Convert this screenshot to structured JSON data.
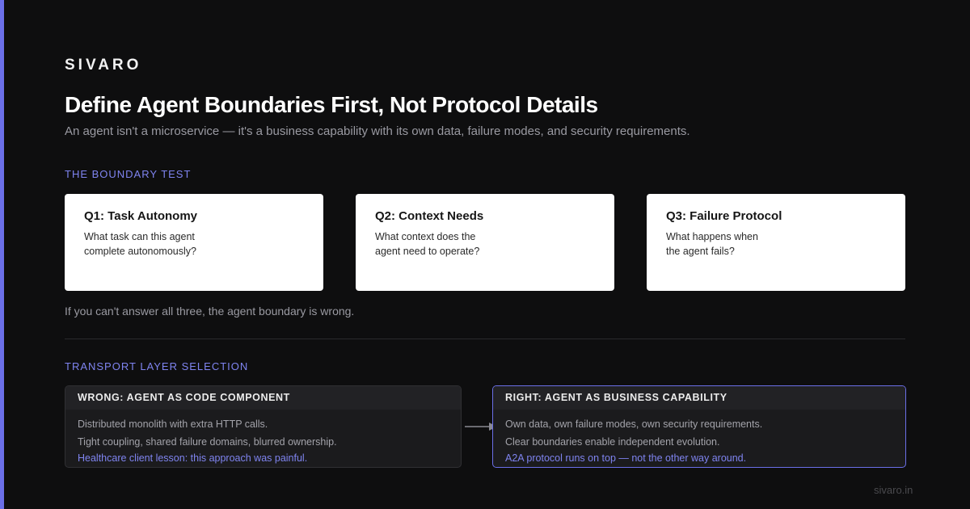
{
  "brand": "SIVARO",
  "title": "Define Agent Boundaries First, Not Protocol Details",
  "subtitle": "An agent isn't a microservice — it's a business capability with its own data, failure modes, and security requirements.",
  "boundary_test": {
    "label": "THE BOUNDARY TEST",
    "questions": [
      {
        "title": "Q1: Task Autonomy",
        "lines": [
          "What task can this agent",
          "complete autonomously?"
        ]
      },
      {
        "title": "Q2: Context Needs",
        "lines": [
          "What context does the",
          "agent need to operate?"
        ]
      },
      {
        "title": "Q3: Failure Protocol",
        "lines": [
          "What happens when",
          "the agent fails?"
        ]
      }
    ],
    "note": "If you can't answer all three, the agent boundary is wrong."
  },
  "transport": {
    "label": "TRANSPORT LAYER SELECTION",
    "wrong": {
      "heading": "WRONG: AGENT AS CODE COMPONENT",
      "lines": [
        "Distributed monolith with extra HTTP calls.",
        "Tight coupling, shared failure domains, blurred ownership."
      ],
      "highlight": "Healthcare client lesson: this approach was painful."
    },
    "right": {
      "heading": "RIGHT: AGENT AS BUSINESS CAPABILITY",
      "lines": [
        "Own data, own failure modes, own security requirements.",
        "Clear boundaries enable independent evolution."
      ],
      "highlight": "A2A protocol runs on top — not the other way around."
    }
  },
  "footer": "sivaro.in",
  "colors": {
    "accent": "#6b6fe8",
    "background": "#0e0e0f",
    "card": "#ffffff"
  }
}
